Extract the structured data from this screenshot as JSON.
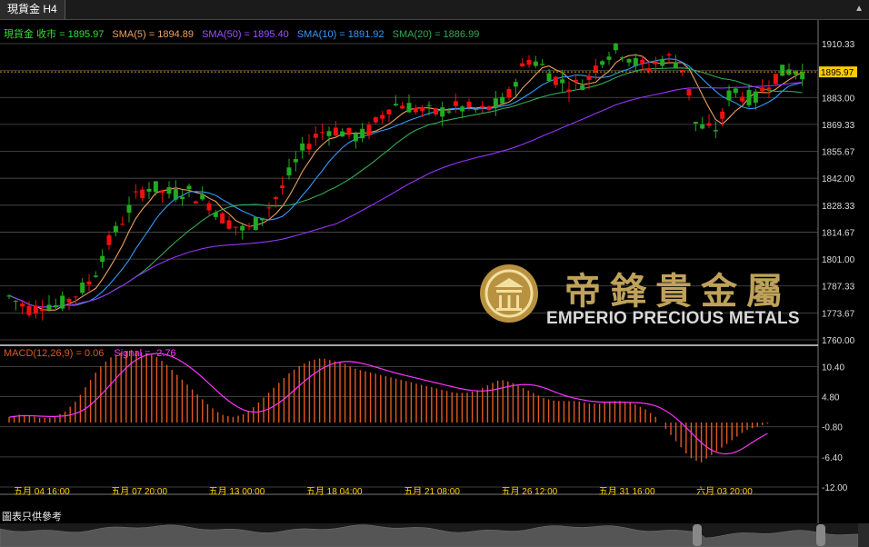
{
  "tab": {
    "title": "現貨金 H4"
  },
  "legend": {
    "symbol": "現貨金 收市 = 1895.97",
    "sma5": "SMA(5) = 1894.89",
    "sma50": "SMA(50) = 1895.40",
    "sma10": "SMA(10) = 1891.92",
    "sma20": "SMA(20) = 1886.99"
  },
  "macd_legend": {
    "macd": "MACD(12,26,9) = 0.06",
    "signal": "Signal = -2.76"
  },
  "watermark": {
    "cn": "帝鋒貴金屬",
    "en": "EMPERIO PRECIOUS METALS"
  },
  "footer": {
    "note": "圖表只供參考"
  },
  "colors": {
    "up": "#22aa22",
    "down": "#ee1111",
    "sma5": "#f0a060",
    "sma10": "#3399ff",
    "sma20": "#33aa55",
    "sma50": "#9933ff",
    "price_line": "#e0a000",
    "macd_hist": "#e05a20",
    "signal": "#ff33ff",
    "legend_symbol": "#33dd33"
  },
  "chart_data": [
    {
      "type": "line",
      "title": "",
      "price_label": "1895.97",
      "y_ticks": [
        1910.33,
        1896.67,
        1883.0,
        1869.33,
        1855.67,
        1842.0,
        1828.33,
        1814.67,
        1801.0,
        1787.33,
        1773.67,
        1760.0
      ],
      "ylim": [
        1760.0,
        1910.33
      ],
      "x_ticks": [
        "五月 04 16:00",
        "五月 07 20:00",
        "五月 13 00:00",
        "五月 18 04:00",
        "五月 21 08:00",
        "五月 26 12:00",
        "五月 31 16:00",
        "六月 03 20:00"
      ],
      "series": [
        {
          "name": "SMA(5)",
          "value": 1894.89
        },
        {
          "name": "SMA(50)",
          "value": 1895.4
        },
        {
          "name": "SMA(10)",
          "value": 1891.92
        },
        {
          "name": "SMA(20)",
          "value": 1886.99
        }
      ],
      "close_path": [
        1782,
        1778,
        1775,
        1779,
        1777,
        1780,
        1785,
        1790,
        1805,
        1815,
        1825,
        1835,
        1838,
        1835,
        1834,
        1836,
        1832,
        1829,
        1822,
        1818,
        1815,
        1820,
        1828,
        1836,
        1848,
        1858,
        1864,
        1867,
        1866,
        1863,
        1864,
        1870,
        1878,
        1880,
        1878,
        1876,
        1875,
        1877,
        1878,
        1877,
        1876,
        1879,
        1881,
        1895,
        1903,
        1899,
        1893,
        1890,
        1889,
        1893,
        1903,
        1907,
        1906,
        1900,
        1898,
        1902,
        1903,
        1897,
        1870,
        1866,
        1868,
        1888,
        1884,
        1882,
        1890,
        1895,
        1897,
        1896
      ]
    },
    {
      "type": "bar",
      "title": "",
      "y_ticks": [
        10.4,
        4.8,
        -0.8,
        -6.4,
        -12.0
      ],
      "ylim": [
        -12.0,
        12.0
      ],
      "macd_value": 0.06,
      "signal_value": -2.76,
      "hist_path": [
        1,
        1.5,
        1.2,
        0.8,
        1,
        2,
        4,
        7,
        10,
        12,
        13,
        13.5,
        13,
        12.5,
        11,
        9,
        7,
        5,
        3,
        1.5,
        1,
        1.5,
        3,
        5,
        7,
        9,
        10.5,
        11.5,
        12,
        11.5,
        11,
        10,
        9.5,
        9,
        8.5,
        8,
        7.5,
        7,
        6.5,
        6,
        5.5,
        5.5,
        6,
        7,
        8,
        7.5,
        6.5,
        5.5,
        4.5,
        4,
        4,
        4,
        3.5,
        3.5,
        4,
        4,
        3.5,
        2.5,
        1,
        -1.5,
        -4,
        -6.5,
        -7.5,
        -6,
        -4.5,
        -3,
        -1.5,
        -0.8,
        -0.2
      ]
    }
  ]
}
